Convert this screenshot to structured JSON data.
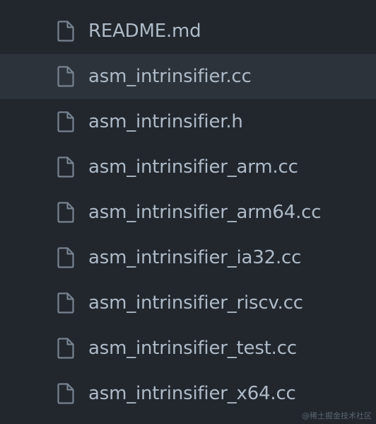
{
  "theme": {
    "background": "#22272e",
    "hover_row": "#2d333b",
    "text": "#adbac7",
    "icon": "#768390"
  },
  "files": [
    {
      "name": "README.md",
      "icon": "file-icon"
    },
    {
      "name": "asm_intrinsifier.cc",
      "icon": "file-icon",
      "hovered": true
    },
    {
      "name": "asm_intrinsifier.h",
      "icon": "file-icon"
    },
    {
      "name": "asm_intrinsifier_arm.cc",
      "icon": "file-icon"
    },
    {
      "name": "asm_intrinsifier_arm64.cc",
      "icon": "file-icon"
    },
    {
      "name": "asm_intrinsifier_ia32.cc",
      "icon": "file-icon"
    },
    {
      "name": "asm_intrinsifier_riscv.cc",
      "icon": "file-icon"
    },
    {
      "name": "asm_intrinsifier_test.cc",
      "icon": "file-icon"
    },
    {
      "name": "asm_intrinsifier_x64.cc",
      "icon": "file-icon"
    }
  ],
  "watermark": "@稀土掘金技术社区"
}
